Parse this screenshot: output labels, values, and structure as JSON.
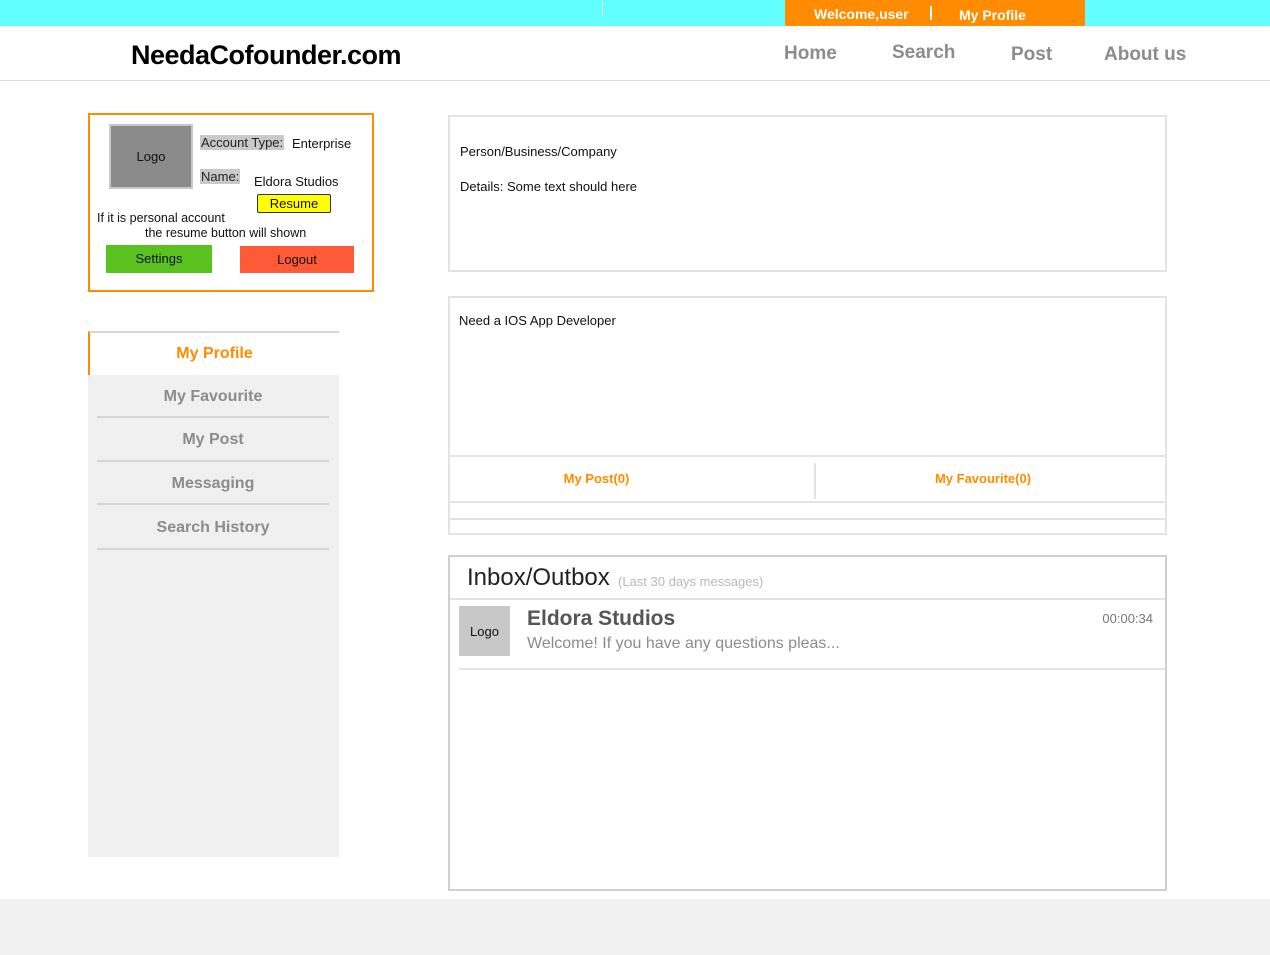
{
  "topbar": {
    "welcome": "Welcome,user",
    "my_profile": "My Profile"
  },
  "header": {
    "brand": "NeedaCofounder.com",
    "nav": {
      "home": "Home",
      "search": "Search",
      "post": "Post",
      "about": "About us"
    }
  },
  "profile_card": {
    "logo": "Logo",
    "account_type_label": "Account Type:",
    "account_type_value": "Enterprise",
    "name_label": "Name:",
    "name_value": "Eldora Studios",
    "resume_button": "Resume",
    "note_line1": "If it is personal account",
    "note_line2": "the resume button will shown",
    "settings_button": "Settings",
    "logout_button": "Logout"
  },
  "sidemenu": {
    "items": [
      {
        "label": "My Profile",
        "active": true
      },
      {
        "label": "My Favourite"
      },
      {
        "label": "My Post"
      },
      {
        "label": "Messaging"
      },
      {
        "label": "Search History"
      }
    ]
  },
  "details_panel": {
    "type_line": "Person/Business/Company",
    "details_line": "Details: Some text should here"
  },
  "post_panel": {
    "need": "Need a IOS App Developer",
    "tabs": {
      "my_post": "My Post(0)",
      "my_favourite": "My Favourite(0)"
    }
  },
  "inbox": {
    "title": "Inbox/Outbox",
    "subtitle": "(Last 30 days messages)",
    "messages": [
      {
        "logo": "Logo",
        "sender": "Eldora Studios",
        "preview": "Welcome! If you have any questions pleas...",
        "time": "00:00:34"
      }
    ]
  },
  "colors": {
    "topbar": "#61ffff",
    "accent": "#ff8c00",
    "settings": "#5ac21e",
    "logout": "#ff5a38",
    "resume": "#ffff00"
  }
}
